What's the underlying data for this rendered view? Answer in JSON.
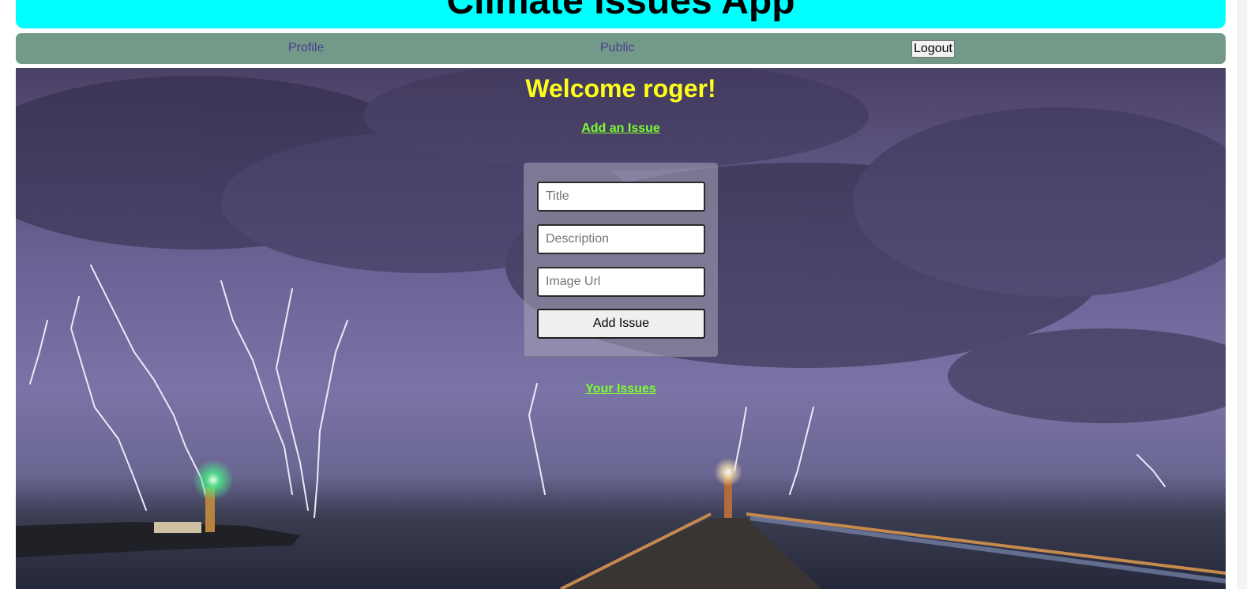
{
  "header": {
    "title": "Climate Issues App"
  },
  "nav": {
    "profile_label": "Profile",
    "public_label": "Public",
    "logout_label": "Logout"
  },
  "main": {
    "welcome": "Welcome roger!",
    "add_issue_link": "Add an Issue",
    "your_issues_link": "Your Issues",
    "background_image": "stormy-sea-lightning-lighthouse-pier"
  },
  "form": {
    "title_placeholder": "Title",
    "description_placeholder": "Description",
    "image_url_placeholder": "Image Url",
    "submit_label": "Add Issue"
  },
  "colors": {
    "header_bg": "#00ffff",
    "nav_bg": "#739a89",
    "nav_link": "#4a3f8e",
    "welcome_text": "#ffff1a",
    "link_text": "#7cff2e"
  }
}
